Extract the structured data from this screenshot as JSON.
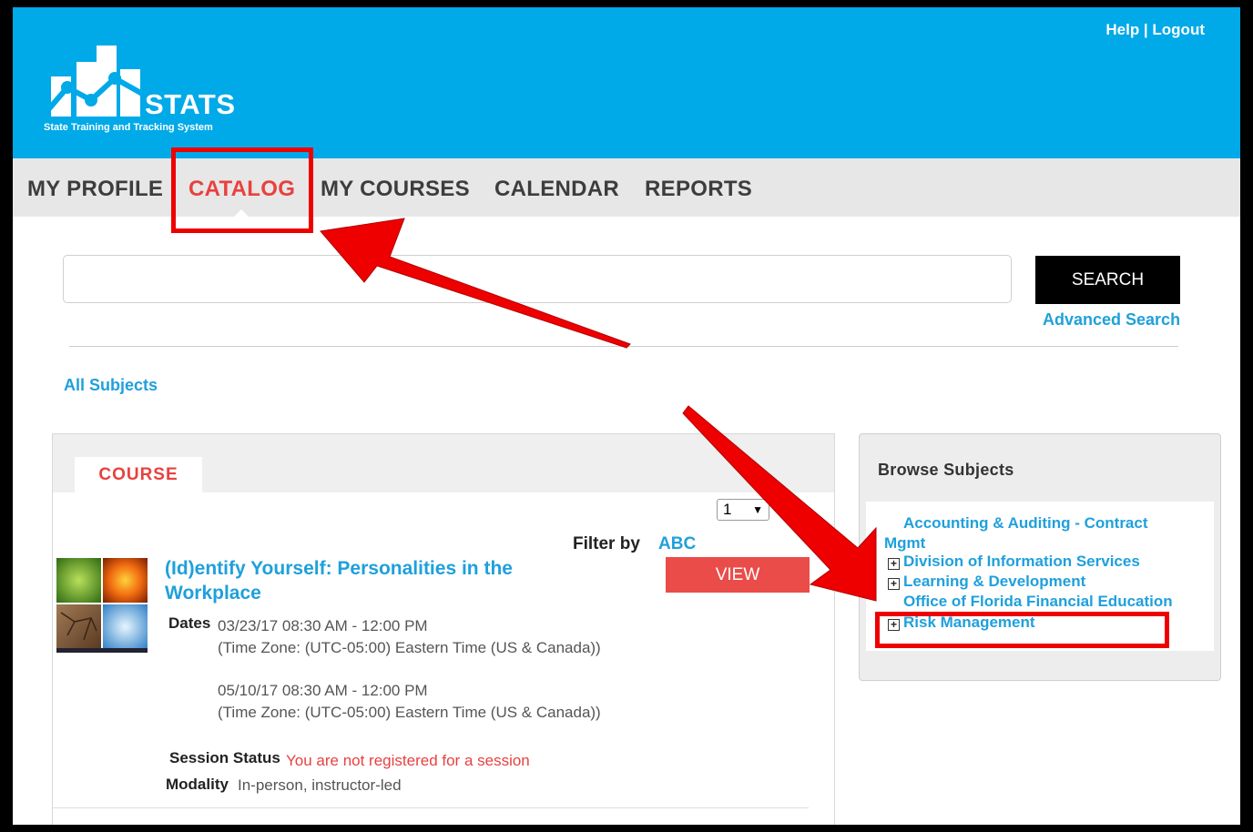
{
  "header": {
    "logo_text": "STATS",
    "logo_subtitle": "State Training and Tracking System",
    "help_label": "Help",
    "separator": " | ",
    "logout_label": "Logout"
  },
  "nav": {
    "items": [
      {
        "label": "MY PROFILE"
      },
      {
        "label": "CATALOG"
      },
      {
        "label": "MY COURSES"
      },
      {
        "label": "CALENDAR"
      },
      {
        "label": "REPORTS"
      }
    ]
  },
  "search": {
    "value": "",
    "button_label": "SEARCH",
    "advanced_label": "Advanced Search"
  },
  "breadcrumb": {
    "all_subjects": "All Subjects"
  },
  "course_panel": {
    "tab_label": "COURSE",
    "page_select_value": "1",
    "filter_label": "Filter by",
    "filter_value": "ABC",
    "course": {
      "title": "(Id)entify Yourself: Personalities in the Workplace",
      "view_label": "VIEW",
      "dates_label": "Dates",
      "sessions": [
        {
          "date": "03/23/17 08:30 AM - 12:00 PM",
          "tz": "(Time Zone: (UTC-05:00) Eastern Time (US & Canada))"
        },
        {
          "date": "05/10/17 08:30 AM - 12:00 PM",
          "tz": "(Time Zone: (UTC-05:00) Eastern Time (US & Canada))"
        }
      ],
      "session_status_label": "Session Status",
      "session_status_value": "You are not registered for a session",
      "modality_label": "Modality",
      "modality_value": "In-person, instructor-led"
    }
  },
  "browse": {
    "title": "Browse Subjects",
    "subjects": [
      {
        "label": "Accounting & Auditing - Contract",
        "label_cont": "Mgmt"
      },
      {
        "label": "Division of Information Services",
        "expand": "+"
      },
      {
        "label": "Learning & Development",
        "expand": "+"
      },
      {
        "label": "Office of Florida Financial Education"
      },
      {
        "label": "Risk Management",
        "expand": "+"
      }
    ]
  },
  "colors": {
    "header_bg": "#00a9e8",
    "accent_red": "#e8413e",
    "link_blue": "#1fa0dc",
    "annotation_red": "#ee0000"
  }
}
